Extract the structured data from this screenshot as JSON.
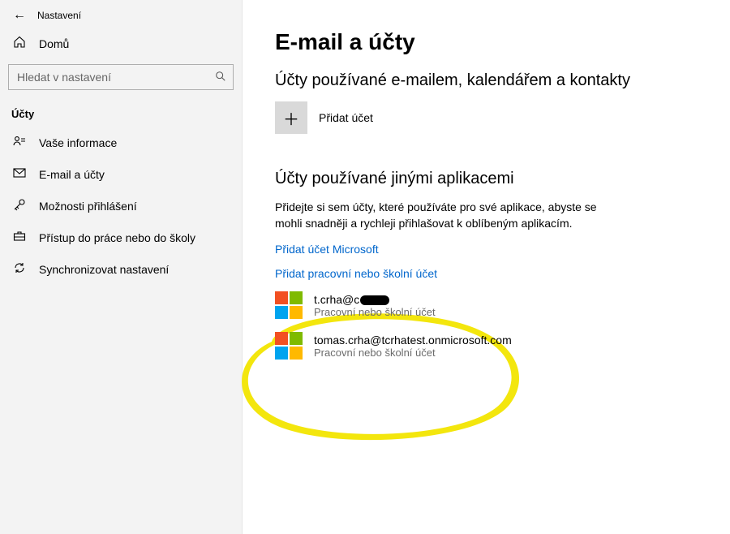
{
  "window": {
    "title": "Nastavení",
    "back_icon": "←"
  },
  "sidebar": {
    "home_label": "Domů",
    "search_placeholder": "Hledat v nastavení",
    "section_header": "Účty",
    "items": [
      {
        "icon": "person",
        "label": "Vaše informace"
      },
      {
        "icon": "mail",
        "label": "E-mail a účty"
      },
      {
        "icon": "key",
        "label": "Možnosti přihlášení"
      },
      {
        "icon": "brief",
        "label": "Přístup do práce nebo do školy"
      },
      {
        "icon": "sync",
        "label": "Synchronizovat nastavení"
      }
    ]
  },
  "main": {
    "title": "E-mail a účty",
    "section1_heading": "Účty používané e-mailem, kalendářem a kontakty",
    "add_account_label": "Přidat účet",
    "section2_heading": "Účty používané jinými aplikacemi",
    "section2_desc": "Přidejte si sem účty, které používáte pro své aplikace, abyste se mohli snadněji a rychleji přihlašovat k oblíbeným aplikacím.",
    "link_add_ms": "Přidat účet Microsoft",
    "link_add_work": "Přidat pracovní nebo školní účet",
    "accounts": [
      {
        "email_prefix": "t.crha@c",
        "type": "Pracovní nebo školní účet"
      },
      {
        "email": "tomas.crha@tcrhatest.onmicrosoft.com",
        "type": "Pracovní nebo školní účet"
      }
    ]
  }
}
